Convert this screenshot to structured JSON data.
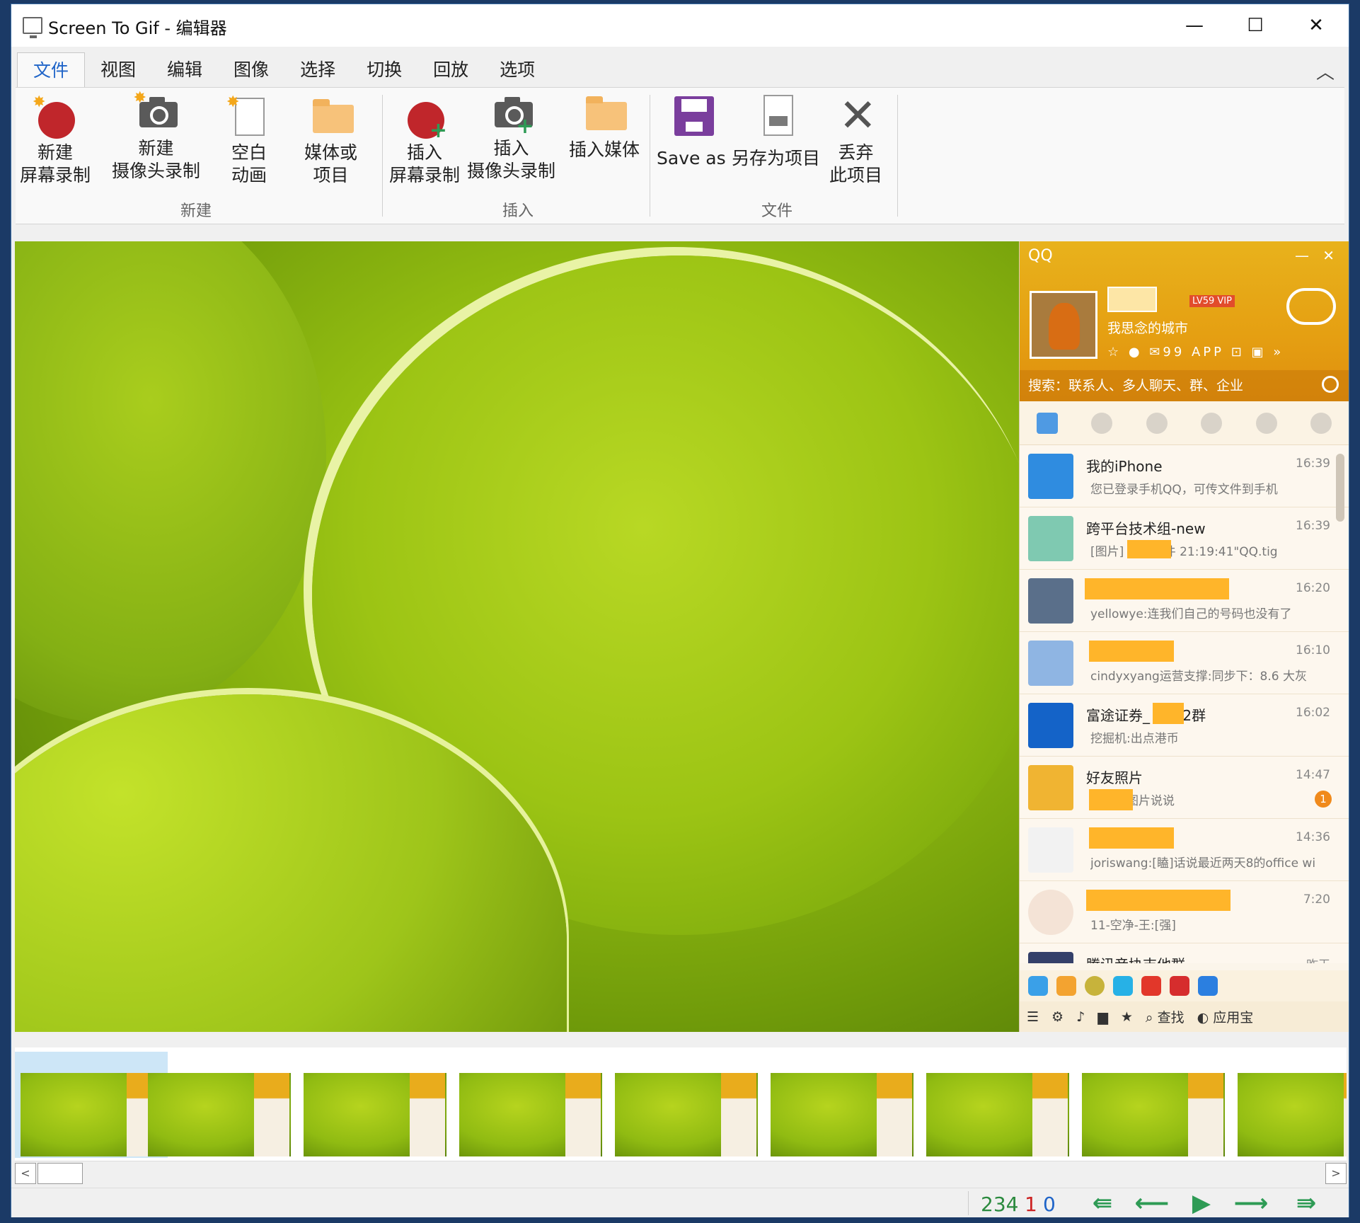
{
  "window": {
    "title": "Screen To Gif - 编辑器",
    "controls": {
      "minimize": "—",
      "maximize": "☐",
      "close": "✕"
    }
  },
  "tabs": [
    "文件",
    "视图",
    "编辑",
    "图像",
    "选择",
    "切换",
    "回放",
    "选项"
  ],
  "ribbon": {
    "collapse_glyph": "︿",
    "groups": [
      {
        "label": "新建",
        "buttons": [
          {
            "line1": "新建",
            "line2": "屏幕录制",
            "icon": "record-icon"
          },
          {
            "line1": "新建",
            "line2": "摄像头录制",
            "icon": "camera-icon"
          },
          {
            "line1": "空白",
            "line2": "动画",
            "icon": "blank-page-icon"
          },
          {
            "line1": "媒体或",
            "line2": "项目",
            "icon": "folder-icon"
          }
        ]
      },
      {
        "label": "插入",
        "buttons": [
          {
            "line1": "插入",
            "line2": "屏幕录制",
            "icon": "insert-record-icon"
          },
          {
            "line1": "插入",
            "line2": "摄像头录制",
            "icon": "insert-camera-icon"
          },
          {
            "line1": "插入媒体",
            "line2": "",
            "icon": "insert-folder-icon"
          }
        ]
      },
      {
        "label": "文件",
        "buttons": [
          {
            "line1": "Save as",
            "line2": "",
            "icon": "save-icon"
          },
          {
            "line1": "另存为项目",
            "line2": "",
            "icon": "save-project-icon"
          },
          {
            "line1": "丢弃",
            "line2": "此项目",
            "icon": "discard-icon"
          }
        ]
      }
    ]
  },
  "qq": {
    "logo": "QQ",
    "level": "LV59",
    "vip": "VIP",
    "status": "我思念的城市",
    "icon_row": "☆ ● ✉99 APP ⊡ ▣ »",
    "mail_count": "99",
    "search_placeholder": "搜索：联系人、多人聊天、群、企业",
    "chats": [
      {
        "name": "我的iPhone",
        "time": "16:39",
        "msg": "您已登录手机QQ，可传文件到手机",
        "avatar_color": "#2f8ce0"
      },
      {
        "name": "跨平台技术组-new",
        "time": "16:39",
        "msg": "[图片]          分享文件 21:19:41\"QQ.tig",
        "avatar_color": "#7fc9b1"
      },
      {
        "name": "",
        "time": "16:20",
        "msg": "yellowye:连我们自己的号码也没有了",
        "avatar_color": "#5a6f8a"
      },
      {
        "name": "",
        "time": "16:10",
        "msg": "cindyxyang运营支撑:同步下：8.6 大灰",
        "avatar_color": "#8fb5e3"
      },
      {
        "name": "富途证券_        客户2群",
        "time": "16:02",
        "msg": "挖掘机:出点港币",
        "avatar_color": "#1463c8"
      },
      {
        "name": "好友照片",
        "time": "14:47",
        "msg": "          发表了图片说说",
        "avatar_color": "#f0b432",
        "badge": "1"
      },
      {
        "name": "",
        "time": "14:36",
        "msg": "joriswang:[瞌]话说最近两天8的office wi",
        "avatar_color": "#f2f2f2"
      },
      {
        "name": "",
        "time": "7:20",
        "msg": "11-空净-王:[强]",
        "avatar_color": "#f4e3d6"
      },
      {
        "name": "腾讯音协吉他群",
        "time": "昨天",
        "msg": "",
        "avatar_color": "#34406a"
      }
    ],
    "bottom_find": "查找",
    "bottom_appstore": "应用宝"
  },
  "status": {
    "total": "234",
    "selected": "1",
    "current": "0"
  },
  "nav": {
    "first": "⇚",
    "prev": "⟵",
    "play": "▶",
    "next": "⟶",
    "last": "⇛"
  },
  "scroll": {
    "left": "<",
    "right": ">"
  }
}
